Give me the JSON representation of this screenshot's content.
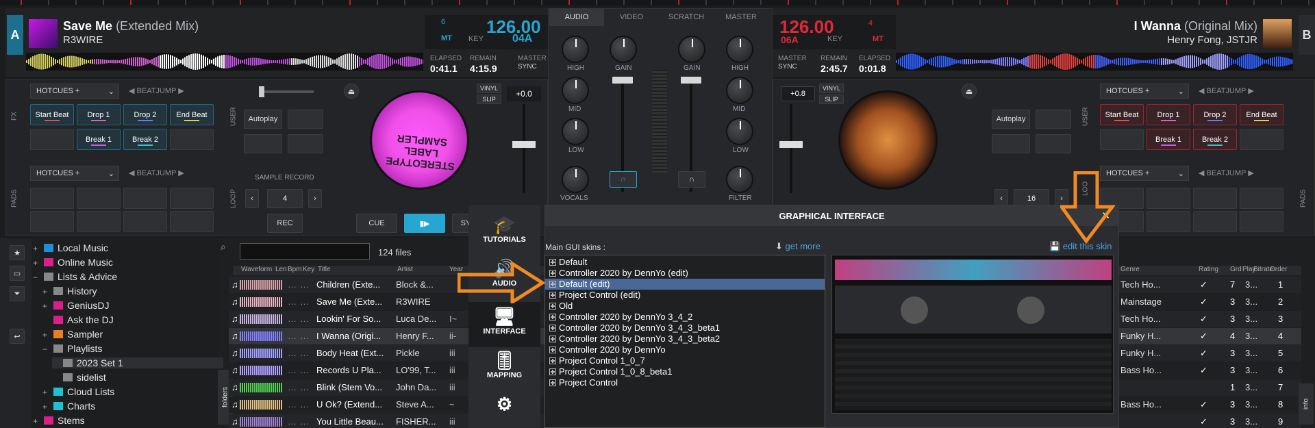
{
  "deckA": {
    "letter": "A",
    "title": "Save Me",
    "mix": "(Extended Mix)",
    "artist": "R3WIRE",
    "bpm": "126.00",
    "pitch_small": "6",
    "mt": "MT",
    "key_label": "KEY",
    "key": "04A",
    "elapsed_label": "ELAPSED",
    "elapsed": "0:41.1",
    "remain_label": "REMAIN",
    "remain": "4:15.9",
    "master_label": "MASTER",
    "sync_label": "SYNC",
    "hotcues_label": "HOTCUES +",
    "beatjump_label": "BEATJUMP",
    "pads": [
      "Start Beat",
      "Drop 1",
      "Drop 2",
      "End Beat",
      "Break 1",
      "Break 2"
    ],
    "autoplay": "Autoplay",
    "pitch": "+0.0",
    "vinyl": "VINYL",
    "slip": "SLIP",
    "sample_record": "SAMPLE RECORD",
    "sample_value": "4",
    "rec": "REC",
    "cue": "CUE",
    "sync_btn": "SY",
    "fx": "FX",
    "user": "USER",
    "pads_side": "PADS",
    "loop": "LOOP",
    "platter_text": "STEREOTYPE LABEL SAMPLER"
  },
  "deckB": {
    "letter": "B",
    "title": "I Wanna",
    "mix": "(Original Mix)",
    "artist": "Henry Fong, JSTJR",
    "bpm": "126.00",
    "pitch_small": "4",
    "mt": "MT",
    "key_label": "KEY",
    "key": "06A",
    "master_label": "MASTER",
    "sync_label": "SYNC",
    "remain_label": "REMAIN",
    "remain": "2:45.7",
    "elapsed_label": "ELAPSED",
    "elapsed": "0:01.8",
    "hotcues_label": "HOTCUES +",
    "beatjump_label": "BEATJUMP",
    "pads": [
      "Start Beat",
      "Drop 1",
      "Drop 2",
      "End Beat",
      "Break 1",
      "Break 2"
    ],
    "autoplay": "Autoplay",
    "pitch": "+0.8",
    "vinyl": "VINYL",
    "slip": "SLIP",
    "loop_value": "16",
    "user": "USER",
    "pads_side": "PADS",
    "loop": "LOO"
  },
  "mixer": {
    "tabs": [
      "AUDIO",
      "VIDEO",
      "SCRATCH",
      "MASTER"
    ],
    "high": "HIGH",
    "mid": "MID",
    "low": "LOW",
    "vocals": "VOCALS",
    "gain": "GAIN",
    "filter": "FILTER"
  },
  "browser": {
    "search_placeholder": "",
    "file_count": "124 files",
    "folders_tab": "folders",
    "info_tab": "info",
    "tree": [
      {
        "sign": "+",
        "label": "Local Music",
        "color": "#1d8fd6"
      },
      {
        "sign": "+",
        "label": "Online Music",
        "color": "#d91f8a"
      },
      {
        "sign": "−",
        "label": "Lists & Advice",
        "color": "#888"
      },
      {
        "sign": "+",
        "label": "History",
        "color": "#888"
      },
      {
        "sign": "+",
        "label": "GeniusDJ",
        "color": "#d91f8a"
      },
      {
        "sign": "",
        "label": "Ask the DJ",
        "color": "#d91f8a"
      },
      {
        "sign": "+",
        "label": "Sampler",
        "color": "#e67e22"
      },
      {
        "sign": "−",
        "label": "Playlists",
        "color": "#888"
      },
      {
        "sign": "",
        "label": "2023 Set 1",
        "color": "#888"
      },
      {
        "sign": "",
        "label": "sidelist",
        "color": "#888"
      },
      {
        "sign": "+",
        "label": "Cloud Lists",
        "color": "#19c3d1"
      },
      {
        "sign": "+",
        "label": "Charts",
        "color": "#19c3d1"
      },
      {
        "sign": "+",
        "label": "Stems",
        "color": "#d91f8a"
      }
    ],
    "columns": [
      "Waveform",
      "Len",
      "Bpm",
      "Key",
      "Title",
      "Artist",
      "Year",
      "Genre",
      "Rating",
      "Grd",
      "Play",
      "Bitrate",
      "Order"
    ],
    "rows": [
      {
        "title": "Children (Exte...",
        "artist": "Block &...",
        "genre": "Tech Ho...",
        "rating": "✓",
        "play": "7",
        "bitrate": "3...",
        "order": "1",
        "year": "",
        "color": "#d8a0a8"
      },
      {
        "title": "Save Me (Exte...",
        "artist": "R3WIRE",
        "genre": "Mainstage",
        "rating": "✓",
        "play": "3",
        "bitrate": "3...",
        "order": "2",
        "year": "",
        "color": "#e8b0c0"
      },
      {
        "title": "Lookin' For So...",
        "artist": "Luca De...",
        "genre": "Tech Ho...",
        "rating": "✓",
        "play": "3",
        "bitrate": "3...",
        "order": "3",
        "year": "I~",
        "color": "#c8b4e0"
      },
      {
        "title": "I Wanna (Origi...",
        "artist": "Henry F...",
        "genre": "Funky H...",
        "rating": "✓",
        "play": "4",
        "bitrate": "3...",
        "order": "4",
        "year": "ii-",
        "color": "#8080ff"
      },
      {
        "title": "Body Heat (Ext...",
        "artist": "Pickle",
        "genre": "Funky H...",
        "rating": "✓",
        "play": "3",
        "bitrate": "3...",
        "order": "5",
        "year": "iii",
        "color": "#a0a0ff"
      },
      {
        "title": "Records U Pla...",
        "artist": "LO'99, T...",
        "genre": "Bass Ho...",
        "rating": "✓",
        "play": "3",
        "bitrate": "3...",
        "order": "6",
        "year": "iii",
        "color": "#b0a0ff"
      },
      {
        "title": "Blink (Stem Vo...",
        "artist": "John Da...",
        "genre": "",
        "rating": "",
        "play": "1",
        "bitrate": "3...",
        "order": "7",
        "year": "iii",
        "color": "#50d050"
      },
      {
        "title": "U Ok? (Extend...",
        "artist": "Steve A...",
        "genre": "Bass Ho...",
        "rating": "✓",
        "play": "3",
        "bitrate": "3...",
        "order": "8",
        "year": "~",
        "color": "#e0c080"
      },
      {
        "title": "You Little Beau...",
        "artist": "FISHER...",
        "genre": "",
        "rating": "✓",
        "play": "3",
        "bitrate": "3...",
        "order": "9",
        "year": "iii",
        "color": "#a080d0"
      }
    ]
  },
  "dialog": {
    "header": "GRAPHICAL INTERFACE",
    "close": "✕",
    "main_skins_label": "Main GUI skins :",
    "get_more": "get more",
    "edit_skin": "edit this skin",
    "nav": [
      "TUTORIALS",
      "AUDIO",
      "INTERFACE",
      "MAPPING"
    ],
    "skins": [
      "Default",
      "Controller 2020 by DennYo (edit)",
      "Default (edit)",
      "Project Control (edit)",
      "Old",
      "Controller 2020 by DennYo 3_4_2",
      "Controller 2020 by DennYo 3_4_3_beta1",
      "Controller 2020 by DennYo 3_4_3_beta2",
      "Controller 2020 by DennYo",
      "Project Control 1_0_7",
      "Project Control 1_0_8_beta1",
      "Project Control"
    ],
    "selected_index": 2
  },
  "colors": {
    "accentA": "#27a6d2",
    "accentB": "#e12a36",
    "orange": "#f08a24",
    "dialog_bg": "#2b2c2f"
  }
}
